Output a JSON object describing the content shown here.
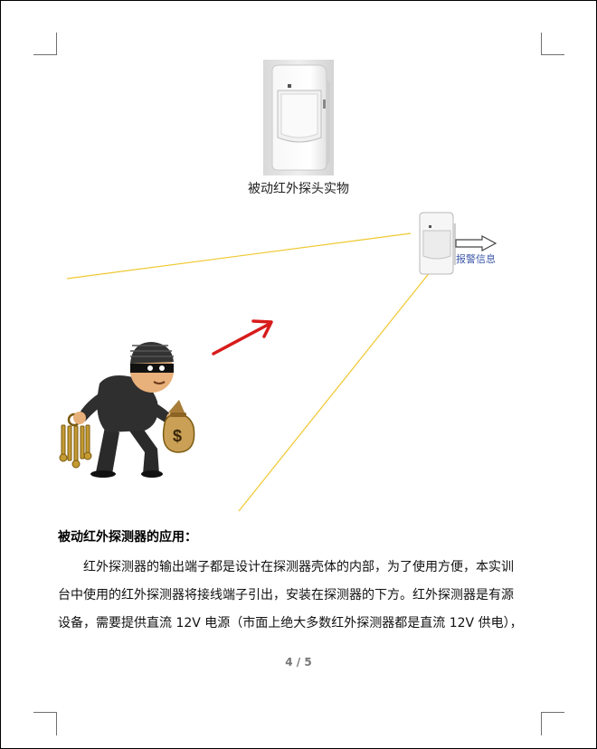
{
  "figure": {
    "caption": "被动红外探头实物",
    "alarm_label": "报警信息"
  },
  "section": {
    "heading": "被动红外探测器的应用：",
    "lines": [
      "红外探测器的输出端子都是设计在探测器壳体的内部，为了使用方便，本实训",
      "台中使用的红外探测器将接线端子引出，安装在探测器的下方。红外探测器是有源",
      "设备，需要提供直流 12V 电源（市面上绝大多数红外探测器都是直流 12V 供电），"
    ]
  },
  "footer": {
    "page_number": "4 / 5"
  },
  "colors": {
    "detection_line": "#f0c830",
    "motion_arrow": "#d81b1b",
    "alarm_text": "#3c57a8"
  },
  "illustrations": {
    "sensor_photo": "pir-sensor-photo",
    "small_sensor": "pir-sensor-icon",
    "thief": "thief-with-keys-and-money-bag",
    "money_symbol": "$"
  }
}
